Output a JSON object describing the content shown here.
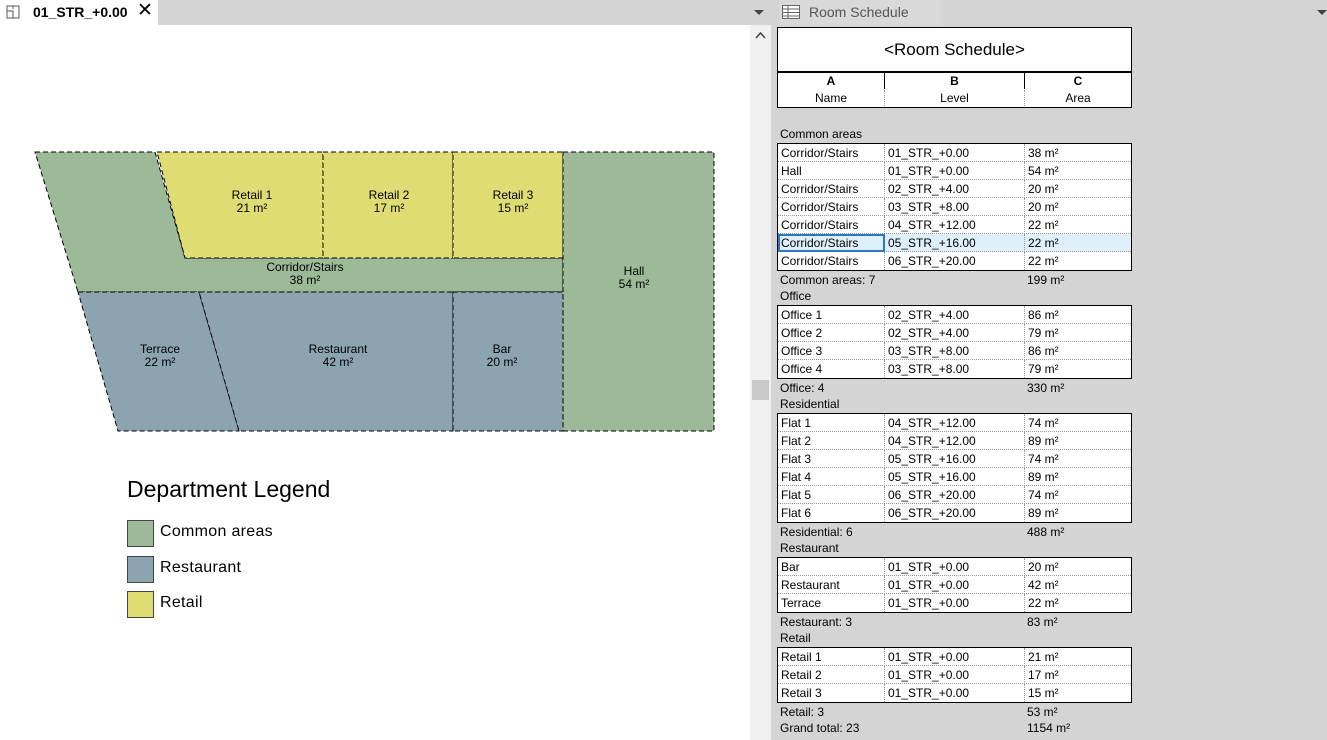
{
  "left_tab": {
    "title": "01_STR_+0.00",
    "close": "✕"
  },
  "right_tab": {
    "title": "Room Schedule"
  },
  "plan": {
    "rooms": [
      {
        "name": "Retail 1",
        "area": "21 m²"
      },
      {
        "name": "Retail 2",
        "area": "17 m²"
      },
      {
        "name": "Retail 3",
        "area": "15 m²"
      },
      {
        "name": "Corridor/Stairs",
        "area": "38 m²"
      },
      {
        "name": "Hall",
        "area": "54 m²"
      },
      {
        "name": "Terrace",
        "area": "22 m²"
      },
      {
        "name": "Restaurant",
        "area": "42 m²"
      },
      {
        "name": "Bar",
        "area": "20 m²"
      }
    ],
    "colors": {
      "common": "#9cba97",
      "restaurant": "#8ca3b0",
      "retail": "#e0dc74"
    }
  },
  "legend": {
    "title": "Department Legend",
    "items": [
      {
        "label": "Common areas",
        "color": "#9cba97"
      },
      {
        "label": "Restaurant",
        "color": "#8ca3b0"
      },
      {
        "label": "Retail",
        "color": "#e0dc74"
      }
    ]
  },
  "schedule": {
    "title": "<Room Schedule>",
    "column_letters": [
      "A",
      "B",
      "C"
    ],
    "column_names": [
      "Name",
      "Level",
      "Area"
    ],
    "groups": [
      {
        "name": "Common areas",
        "rows": [
          [
            "Corridor/Stairs",
            "01_STR_+0.00",
            "38 m²"
          ],
          [
            "Hall",
            "01_STR_+0.00",
            "54 m²"
          ],
          [
            "Corridor/Stairs",
            "02_STR_+4.00",
            "20 m²"
          ],
          [
            "Corridor/Stairs",
            "03_STR_+8.00",
            "20 m²"
          ],
          [
            "Corridor/Stairs",
            "04_STR_+12.00",
            "22 m²"
          ],
          [
            "Corridor/Stairs",
            "05_STR_+16.00",
            "22 m²"
          ],
          [
            "Corridor/Stairs",
            "06_STR_+20.00",
            "22 m²"
          ]
        ],
        "total_label": "Common areas: 7",
        "total_area": "199 m²"
      },
      {
        "name": "Office",
        "rows": [
          [
            "Office 1",
            "02_STR_+4.00",
            "86 m²"
          ],
          [
            "Office 2",
            "02_STR_+4.00",
            "79 m²"
          ],
          [
            "Office 3",
            "03_STR_+8.00",
            "86 m²"
          ],
          [
            "Office 4",
            "03_STR_+8.00",
            "79 m²"
          ]
        ],
        "total_label": "Office: 4",
        "total_area": "330 m²"
      },
      {
        "name": "Residential",
        "rows": [
          [
            "Flat 1",
            "04_STR_+12.00",
            "74 m²"
          ],
          [
            "Flat 2",
            "04_STR_+12.00",
            "89 m²"
          ],
          [
            "Flat 3",
            "05_STR_+16.00",
            "74 m²"
          ],
          [
            "Flat 4",
            "05_STR_+16.00",
            "89 m²"
          ],
          [
            "Flat 5",
            "06_STR_+20.00",
            "74 m²"
          ],
          [
            "Flat 6",
            "06_STR_+20.00",
            "89 m²"
          ]
        ],
        "total_label": "Residential: 6",
        "total_area": "488 m²"
      },
      {
        "name": "Restaurant",
        "rows": [
          [
            "Bar",
            "01_STR_+0.00",
            "20 m²"
          ],
          [
            "Restaurant",
            "01_STR_+0.00",
            "42 m²"
          ],
          [
            "Terrace",
            "01_STR_+0.00",
            "22 m²"
          ]
        ],
        "total_label": "Restaurant: 3",
        "total_area": "83 m²"
      },
      {
        "name": "Retail",
        "rows": [
          [
            "Retail 1",
            "01_STR_+0.00",
            "21 m²"
          ],
          [
            "Retail 2",
            "01_STR_+0.00",
            "17 m²"
          ],
          [
            "Retail 3",
            "01_STR_+0.00",
            "15 m²"
          ]
        ],
        "total_label": "Retail: 3",
        "total_area": "53 m²"
      }
    ],
    "selected_row": {
      "group": 0,
      "row": 5
    },
    "grand_total_label": "Grand total: 23",
    "grand_total_area": "1154 m²"
  }
}
